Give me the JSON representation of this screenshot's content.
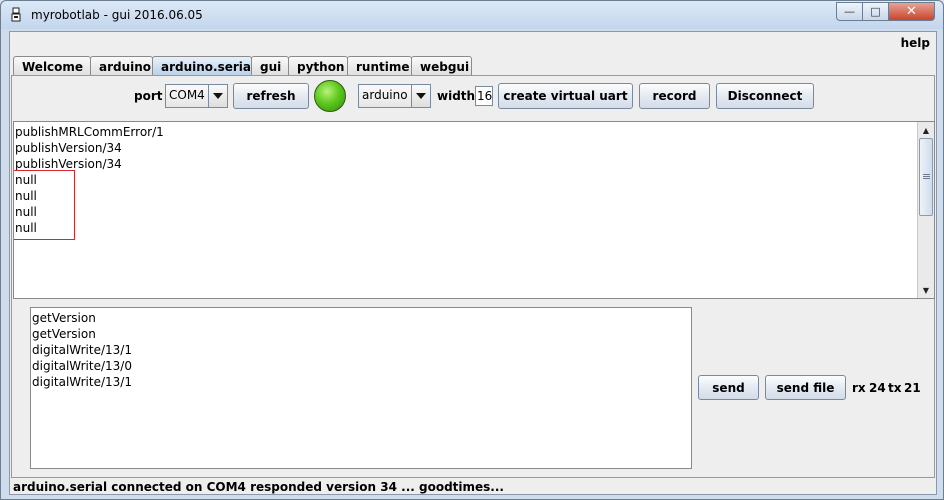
{
  "window": {
    "title": "myrobotlab - gui 2016.06.05",
    "icon": "robot-icon",
    "controls": [
      "minimize",
      "maximize",
      "close"
    ]
  },
  "menubar": {
    "help_label": "help"
  },
  "tabs": [
    {
      "label": "Welcome",
      "active": false
    },
    {
      "label": "arduino",
      "active": false
    },
    {
      "label": "arduino.serial",
      "active": true
    },
    {
      "label": "gui",
      "active": false
    },
    {
      "label": "python",
      "active": false
    },
    {
      "label": "runtime",
      "active": false
    },
    {
      "label": "webgui",
      "active": false
    }
  ],
  "toolbar": {
    "port_label": "port",
    "port_value": "COM4",
    "refresh_label": "refresh",
    "status_led_color": "#5fc91e",
    "format_value": "arduino",
    "width_label": "width",
    "width_value": "16",
    "create_virtual_uart_label": "create virtual uart",
    "record_label": "record",
    "disconnect_label": "Disconnect"
  },
  "rx_area": {
    "lines": [
      "publishMRLCommError/1",
      "publishVersion/34",
      "publishVersion/34",
      "null",
      "null",
      "null",
      "null"
    ],
    "highlight_color": "#d9252c"
  },
  "tx_area": {
    "lines": [
      "getVersion",
      "getVersion",
      "digitalWrite/13/1",
      "digitalWrite/13/0",
      "digitalWrite/13/1"
    ]
  },
  "send_panel": {
    "send_label": "send",
    "send_file_label": "send file",
    "rx_label": "rx",
    "rx_count": "24",
    "tx_label": "tx",
    "tx_count": "21"
  },
  "status": {
    "text": "arduino.serial connected on COM4 responded version 34 ... goodtimes..."
  }
}
